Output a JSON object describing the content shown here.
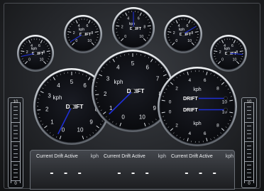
{
  "colors": {
    "needle": "#1f2fd6",
    "pointer_dot": "#0a0a0a",
    "bezel": "#c8ccd2",
    "face": "#121318",
    "text": "#e8ebef"
  },
  "small_gauges": [
    {
      "name": "gauge-small-1",
      "unit": "kph",
      "label": "DRIFT",
      "ticks": [
        "0",
        "2",
        "4",
        "6",
        "8",
        "10"
      ],
      "value_fraction": 0.12
    },
    {
      "name": "gauge-small-2",
      "unit": "kph",
      "label": "DRIFT",
      "ticks": [
        "0",
        "2",
        "4",
        "6",
        "8",
        "10"
      ],
      "value_fraction": 0.05
    },
    {
      "name": "gauge-small-3",
      "unit": "kph",
      "label": "DRIFT",
      "ticks": [
        "0",
        "2",
        "4",
        "6",
        "8",
        "10"
      ],
      "value_fraction": 0.5
    },
    {
      "name": "gauge-small-4",
      "unit": "kph",
      "label": "DRIFT",
      "ticks": [
        "0",
        "2",
        "4",
        "6",
        "8",
        "10"
      ],
      "value_fraction": 0.72
    },
    {
      "name": "gauge-small-5",
      "unit": "kph",
      "label": "DRIFT",
      "ticks": [
        "0",
        "2",
        "4",
        "6",
        "8",
        "10"
      ],
      "value_fraction": 0.85
    }
  ],
  "large_gauges": [
    {
      "name": "gauge-large-left",
      "unit": "kph",
      "label": "DRIFT",
      "ticks": [
        "0",
        "1",
        "2",
        "3",
        "4",
        "5",
        "6",
        "7",
        "8",
        "9",
        "10"
      ],
      "value_fraction": 0.02
    },
    {
      "name": "gauge-large-center",
      "unit": "kph",
      "label": "DRIFT",
      "ticks": [
        "0",
        "1",
        "2",
        "3",
        "4",
        "5",
        "6",
        "7",
        "8",
        "9",
        "10"
      ],
      "value_fraction": 0.08
    }
  ],
  "dual_gauge": {
    "unit": "kph",
    "labels": [
      "DRIFT",
      "DRIFT"
    ],
    "top_ticks": [
      "0",
      "2",
      "4",
      "6",
      "8",
      "10"
    ],
    "bottom_ticks": [
      "0",
      "2",
      "4",
      "6",
      "8",
      "10"
    ]
  },
  "side_meters": {
    "left": {
      "top": "10",
      "bottom": "0"
    },
    "right": {
      "top": "10",
      "bottom": "0"
    }
  },
  "readouts": [
    {
      "label": "Current Drift Active",
      "unit": "kph",
      "value": "- - -"
    },
    {
      "label": "Current Drift Active",
      "unit": "kph",
      "value": "- - -"
    },
    {
      "label": "Current Drift Active",
      "unit": "kph",
      "value": "- - -"
    }
  ]
}
